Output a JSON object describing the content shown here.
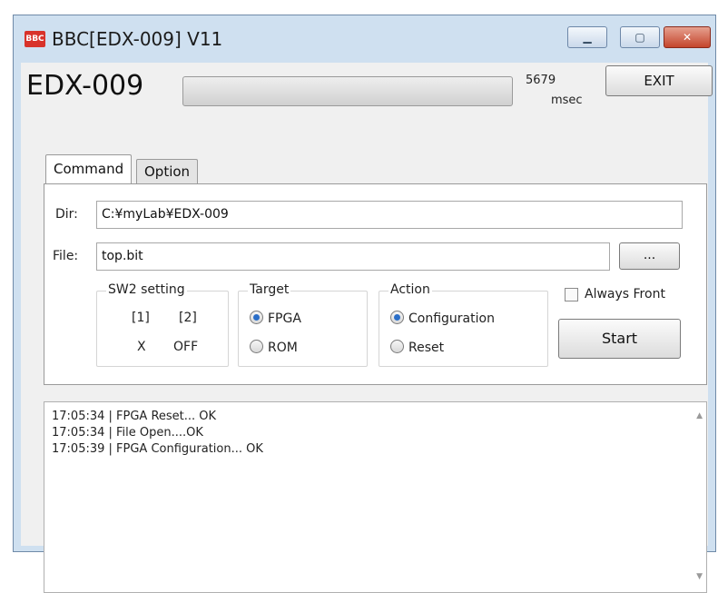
{
  "window": {
    "app_icon": "BBC",
    "title": "BBC[EDX-009] V11",
    "min_icon": "minimize-icon",
    "max_icon": "maximize-icon",
    "close_icon": "close-icon"
  },
  "header": {
    "device_name": "EDX-009",
    "progress_fraction": 0,
    "time_value": "5679",
    "time_unit": "msec",
    "exit_label": "EXIT"
  },
  "tabs": [
    {
      "label": "Command",
      "active": true
    },
    {
      "label": "Option",
      "active": false
    }
  ],
  "command": {
    "dir_label": "Dir:",
    "dir_value": "C:¥myLab¥EDX-009",
    "file_label": "File:",
    "file_value": "top.bit",
    "browse_label": "...",
    "sw2": {
      "title": "SW2 setting",
      "col1": "[1]",
      "col2": "[2]",
      "val1": "X",
      "val2": "OFF"
    },
    "target": {
      "title": "Target",
      "options": [
        {
          "label": "FPGA",
          "selected": true
        },
        {
          "label": "ROM",
          "selected": false
        }
      ]
    },
    "action": {
      "title": "Action",
      "options": [
        {
          "label": "Configuration",
          "selected": true
        },
        {
          "label": "Reset",
          "selected": false
        }
      ]
    },
    "always_front_label": "Always Front",
    "always_front_checked": false,
    "start_label": "Start"
  },
  "log": {
    "lines": [
      "17:05:34 | FPGA Reset... OK",
      "17:05:34 | File Open....OK",
      "17:05:39 | FPGA Configuration... OK"
    ]
  },
  "colors": {
    "frame": "#cfe0f0",
    "close_button": "#c4452c",
    "radio_selected": "#2a6ec8"
  }
}
